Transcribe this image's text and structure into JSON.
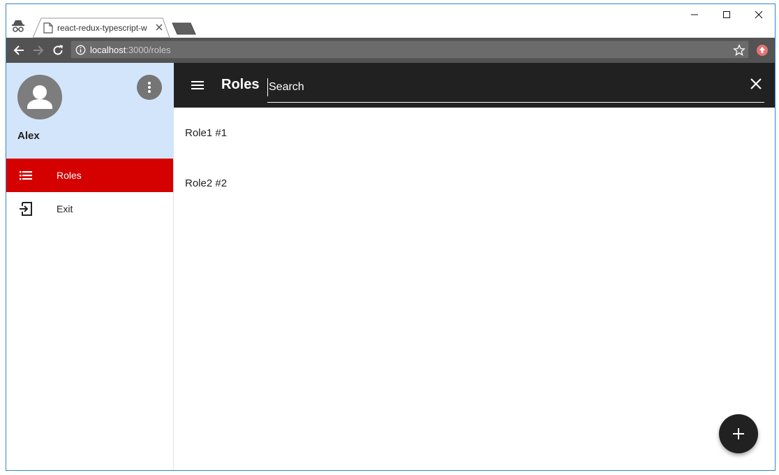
{
  "browser": {
    "tab_title": "react-redux-typescript-w",
    "url_host": "localhost",
    "url_path": ":3000/roles"
  },
  "sidebar": {
    "user_name": "Alex",
    "items": [
      {
        "label": "Roles",
        "icon": "list-icon",
        "active": true
      },
      {
        "label": "Exit",
        "icon": "exit-icon",
        "active": false
      }
    ]
  },
  "appbar": {
    "title": "Roles",
    "search_placeholder": "Search"
  },
  "roles": [
    {
      "label": "Role1 #1"
    },
    {
      "label": "Role2 #2"
    }
  ],
  "colors": {
    "accent_active": "#d50000",
    "appbar": "#212121",
    "profile_bg": "#d3e5fb"
  }
}
